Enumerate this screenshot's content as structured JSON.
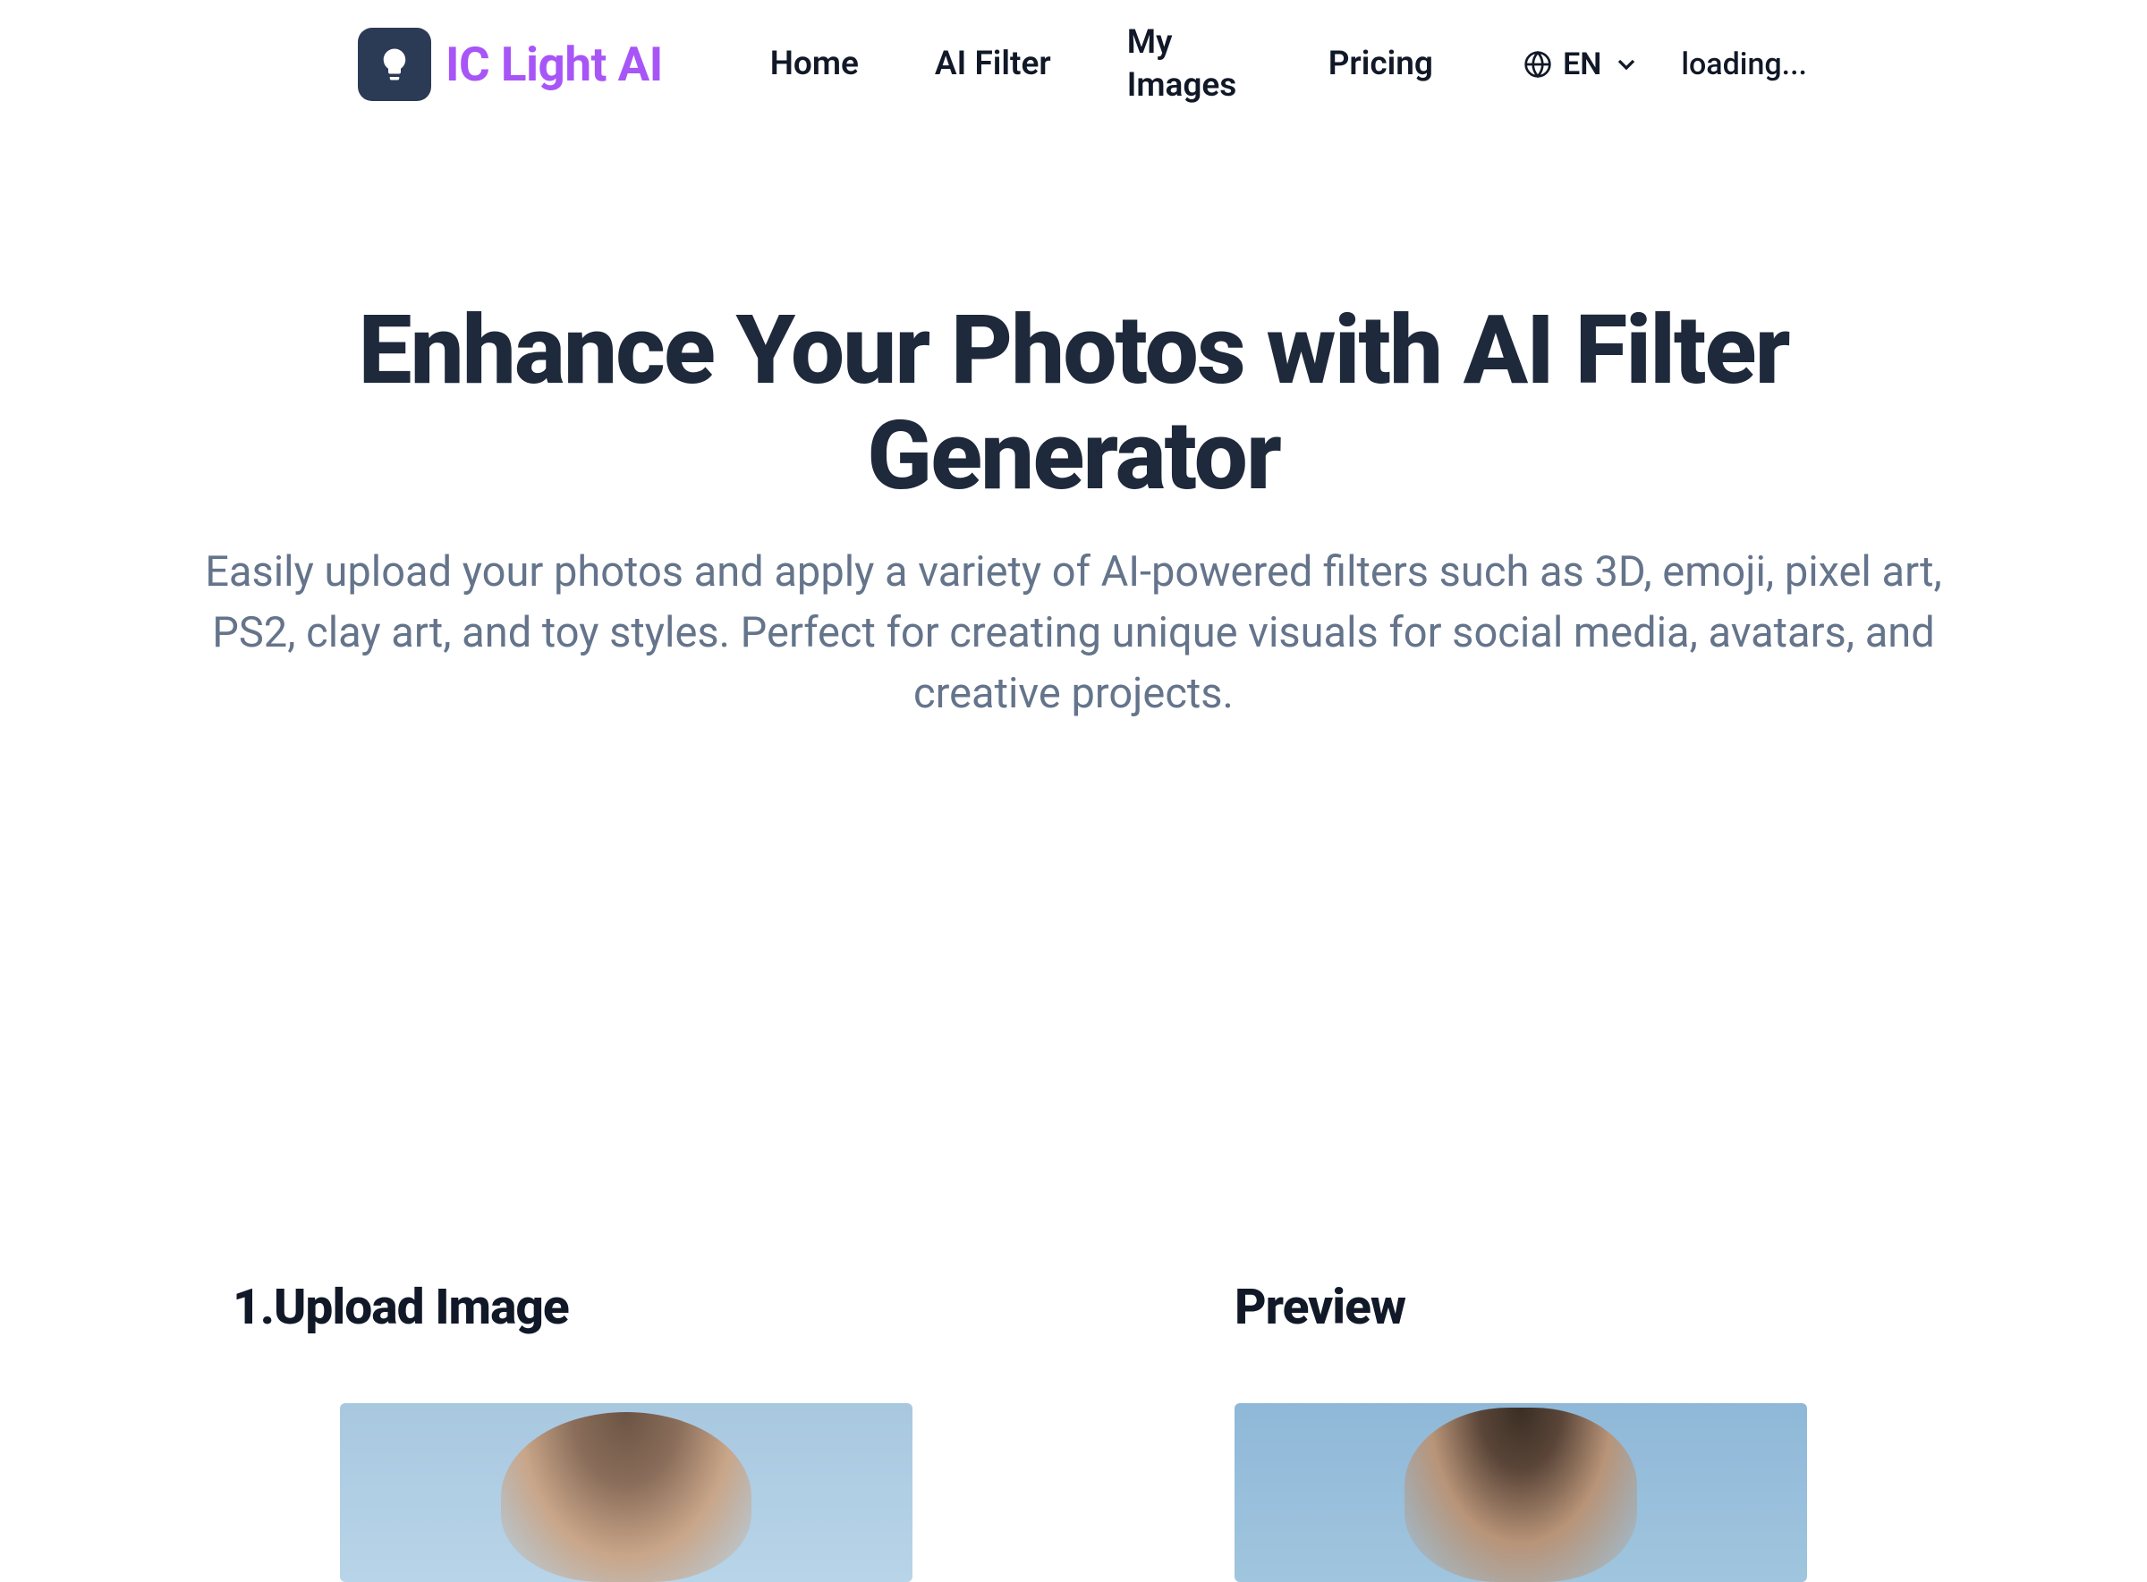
{
  "header": {
    "brand": "IC Light AI",
    "nav": {
      "home": "Home",
      "ai_filter": "AI Filter",
      "my_images": "My Images",
      "pricing": "Pricing"
    },
    "language": "EN",
    "status": "loading..."
  },
  "hero": {
    "title": "Enhance Your Photos with AI Filter Generator",
    "subtitle": "Easily upload your photos and apply a variety of AI-powered filters such as 3D, emoji, pixel art, PS2, clay art, and toy styles. Perfect for creating unique visuals for social media, avatars, and creative projects."
  },
  "sections": {
    "upload": "1.Upload Image",
    "preview": "Preview"
  }
}
